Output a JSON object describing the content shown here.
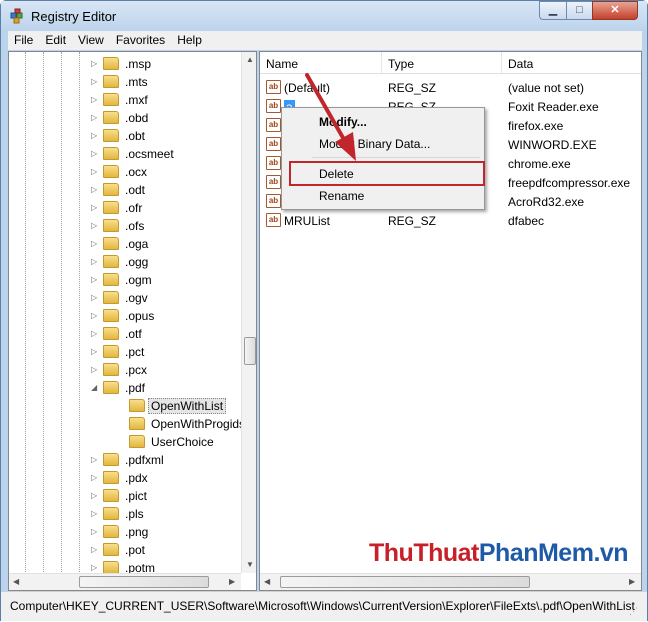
{
  "window": {
    "title": "Registry Editor",
    "minimize_glyph": "▁",
    "maximize_glyph": "□",
    "close_glyph": "✕"
  },
  "menubar": {
    "items": [
      "File",
      "Edit",
      "View",
      "Favorites",
      "Help"
    ]
  },
  "tree": {
    "items": [
      {
        "label": ".msp",
        "expander": "▷"
      },
      {
        "label": ".mts",
        "expander": "▷"
      },
      {
        "label": ".mxf",
        "expander": "▷"
      },
      {
        "label": ".obd",
        "expander": "▷"
      },
      {
        "label": ".obt",
        "expander": "▷"
      },
      {
        "label": ".ocsmeet",
        "expander": "▷"
      },
      {
        "label": ".ocx",
        "expander": "▷"
      },
      {
        "label": ".odt",
        "expander": "▷"
      },
      {
        "label": ".ofr",
        "expander": "▷"
      },
      {
        "label": ".ofs",
        "expander": "▷"
      },
      {
        "label": ".oga",
        "expander": "▷"
      },
      {
        "label": ".ogg",
        "expander": "▷"
      },
      {
        "label": ".ogm",
        "expander": "▷"
      },
      {
        "label": ".ogv",
        "expander": "▷"
      },
      {
        "label": ".opus",
        "expander": "▷"
      },
      {
        "label": ".otf",
        "expander": "▷"
      },
      {
        "label": ".pct",
        "expander": "▷"
      },
      {
        "label": ".pcx",
        "expander": "▷"
      },
      {
        "label": ".pdf",
        "expander": "◢"
      },
      {
        "label": "OpenWithList",
        "expander": "",
        "child": true,
        "selected": true
      },
      {
        "label": "OpenWithProgids",
        "expander": "",
        "child": true
      },
      {
        "label": "UserChoice",
        "expander": "",
        "child": true
      },
      {
        "label": ".pdfxml",
        "expander": "▷"
      },
      {
        "label": ".pdx",
        "expander": "▷"
      },
      {
        "label": ".pict",
        "expander": "▷"
      },
      {
        "label": ".pls",
        "expander": "▷"
      },
      {
        "label": ".png",
        "expander": "▷"
      },
      {
        "label": ".pot",
        "expander": "▷"
      },
      {
        "label": ".potm",
        "expander": "▷"
      }
    ]
  },
  "list": {
    "columns": [
      "Name",
      "Type",
      "Data"
    ],
    "icon_text": "ab",
    "rows": [
      {
        "name": "(Default)",
        "type": "REG_SZ",
        "data": "(value not set)"
      },
      {
        "name": "a",
        "type": "REG_SZ",
        "data": "Foxit Reader.exe",
        "selected": true
      },
      {
        "name": "",
        "type": "",
        "data": "firefox.exe"
      },
      {
        "name": "",
        "type": "",
        "data": "WINWORD.EXE"
      },
      {
        "name": "",
        "type": "",
        "data": "chrome.exe"
      },
      {
        "name": "",
        "type": "",
        "data": "freepdfcompressor.exe"
      },
      {
        "name": "",
        "type": "",
        "data": "AcroRd32.exe"
      },
      {
        "name": "MRUList",
        "type": "REG_SZ",
        "data": "dfabec"
      }
    ]
  },
  "context_menu": {
    "modify": "Modify...",
    "modify_binary": "Modify Binary Data...",
    "delete": "Delete",
    "rename": "Rename"
  },
  "watermark": {
    "part1": "ThuThuat",
    "part2": "PhanMem",
    "part3": ".vn",
    "color1": "#c8202a",
    "color2": "#1e5aa8"
  },
  "statusbar": {
    "path": "Computer\\HKEY_CURRENT_USER\\Software\\Microsoft\\Windows\\CurrentVersion\\Explorer\\FileExts\\.pdf\\OpenWithList"
  },
  "colors": {
    "highlight_box": "#c0262b",
    "arrow": "#c0262b",
    "selection": "#3399ff"
  }
}
